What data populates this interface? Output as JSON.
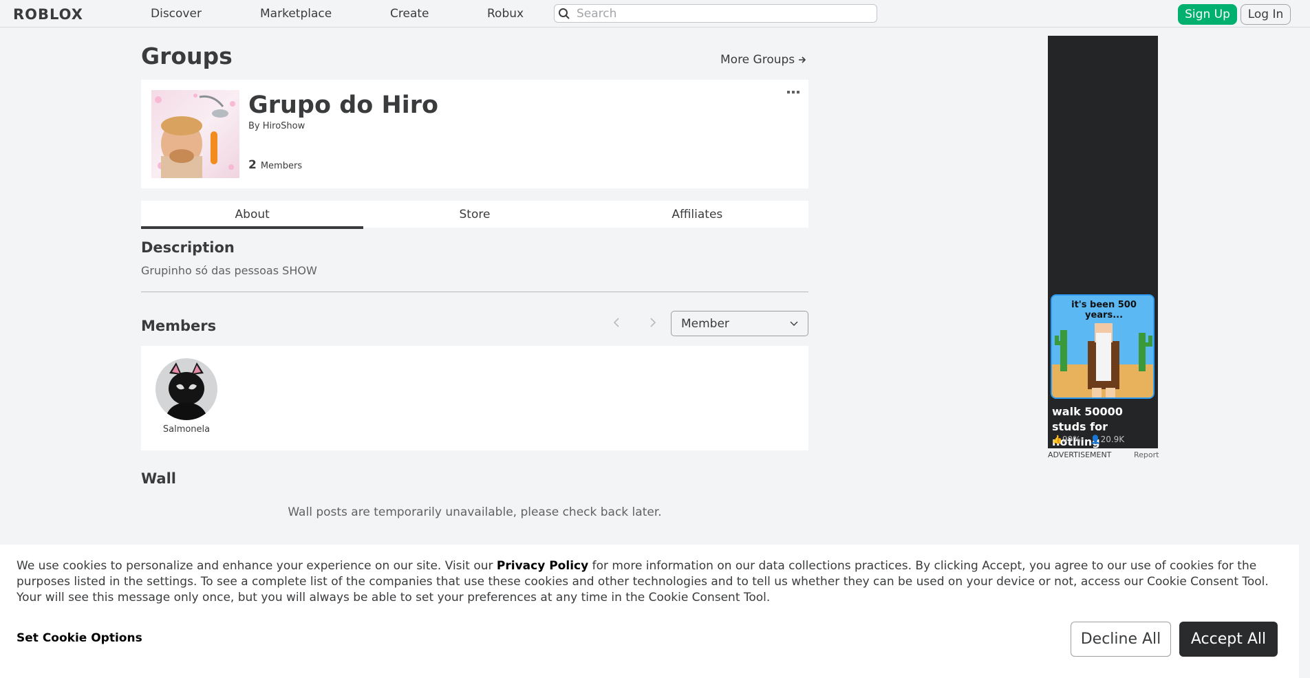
{
  "header": {
    "logo": "ROBLOX",
    "nav": [
      "Discover",
      "Marketplace",
      "Create",
      "Robux"
    ],
    "search_placeholder": "Search",
    "signup_label": "Sign Up",
    "login_label": "Log In"
  },
  "page": {
    "title": "Groups",
    "more_groups_label": "More Groups"
  },
  "group": {
    "name": "Grupo do Hiro",
    "by_prefix": "By",
    "owner": "HiroShow",
    "member_count": "2",
    "members_label": "Members"
  },
  "tabs": [
    "About",
    "Store",
    "Affiliates"
  ],
  "about": {
    "description_title": "Description",
    "description_text": "Grupinho só das pessoas SHOW",
    "members_title": "Members",
    "role_select": "Member",
    "members": [
      {
        "name": "Salmonela"
      }
    ],
    "wall_title": "Wall",
    "wall_message": "Wall posts are temporarily unavailable, please check back later."
  },
  "ad": {
    "caption": "it's been 500 years...",
    "title": "walk 50000 studs for nothing",
    "rating": "99%",
    "players": "20.9K",
    "label": "ADVERTISEMENT",
    "report": "Report"
  },
  "cookie": {
    "text_before": "We use cookies to personalize and enhance your experience on our site. Visit our",
    "link": "Privacy Policy",
    "text_after": "for more information on our data collections practices. By clicking Accept, you agree to our use of cookies for the purposes listed in the settings. To see a complete list of the companies that use these cookies and other technologies and to tell us whether they can be used on your device or not, access our Cookie Consent Tool. Your will see this message only once, but you will always be able to set your preferences at any time in the Cookie Consent Tool.",
    "set_options_label": "Set Cookie Options",
    "decline_label": "Decline All",
    "accept_label": "Accept All"
  },
  "colors": {
    "signup": "#00b06f",
    "accept": "#2a2b2c",
    "ad_bg": "#232527"
  }
}
